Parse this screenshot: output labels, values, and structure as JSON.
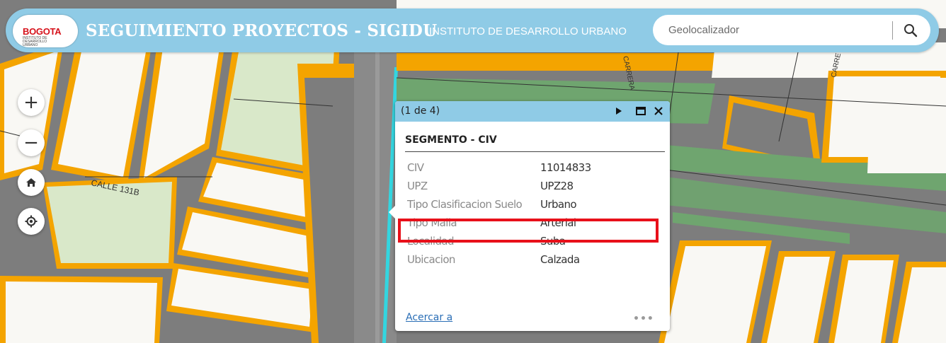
{
  "header": {
    "logo_text": "BOGOTA",
    "logo_subtitle": "INSTITUTO DE DESARROLLO URBANO",
    "title": "SEGUIMIENTO PROYECTOS - SIGIDU",
    "subtitle": "INSTITUTO DE DESARROLLO URBANO"
  },
  "search": {
    "placeholder": "Geolocalizador",
    "value": ""
  },
  "map_controls": {
    "zoom_in": "+",
    "zoom_out": "−"
  },
  "street_labels": [
    "CALLE 131B",
    "CARRERA",
    "CARRE"
  ],
  "popup": {
    "count": "(1 de 4)",
    "title": "SEGMENTO - CIV",
    "attributes": [
      {
        "key": "CIV",
        "value": "11014833"
      },
      {
        "key": "UPZ",
        "value": "UPZ28"
      },
      {
        "key": "Tipo Clasificacion Suelo",
        "value": "Urbano"
      },
      {
        "key": "Tipo Malla",
        "value": "Arterial"
      },
      {
        "key": "Localidad",
        "value": "Suba"
      },
      {
        "key": "Ubicacion",
        "value": "Calzada"
      }
    ],
    "highlighted_attribute": "Tipo Malla",
    "zoom_link": "Acercar a",
    "more": "•••"
  },
  "colors": {
    "header": "#8fcbe6",
    "road": "#7d7d7d",
    "block": "#f9f8f4",
    "parcel_border": "#f5a500",
    "park": "#d9e8c9",
    "median": "#6fa56f",
    "highlight": "#e8101a",
    "link": "#2a6eb6",
    "selected_segment": "#33d6e0"
  }
}
